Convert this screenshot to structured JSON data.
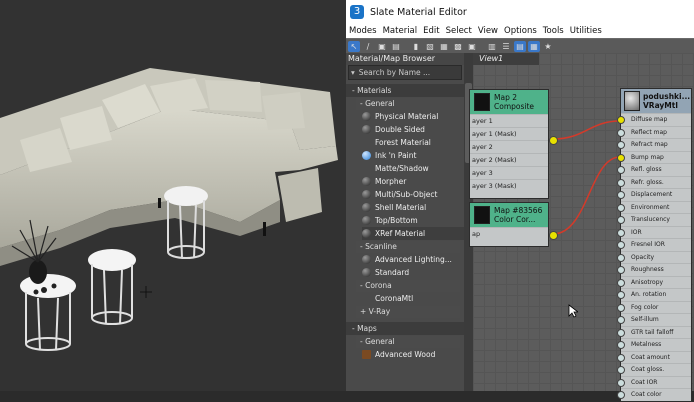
{
  "window": {
    "title": "Slate Material Editor",
    "icon_letter": "3"
  },
  "menu": [
    "Modes",
    "Material",
    "Edit",
    "Select",
    "View",
    "Options",
    "Tools",
    "Utilities"
  ],
  "browser": {
    "title": "Material/Map Browser",
    "search_placeholder": "Search by Name ...",
    "sections": {
      "materials": "- Materials",
      "general": "- General",
      "scanline": "- Scanline",
      "corona": "- Corona",
      "vray": "+ V-Ray",
      "maps": "- Maps",
      "maps_general": "- General"
    },
    "general_items": [
      "Physical Material",
      "Double Sided",
      "Forest Material",
      "Ink 'n Paint",
      "Matte/Shadow",
      "Morpher",
      "Multi/Sub-Object",
      "Shell Material",
      "Top/Bottom",
      "XRef Material"
    ],
    "scanline_items": [
      "Advanced Lighting...",
      "Standard"
    ],
    "corona_items": [
      "CoronaMtl"
    ],
    "maps_items": [
      "Advanced Wood"
    ]
  },
  "view": {
    "tab_label": "View1",
    "node_composite": {
      "title1": "Map 2",
      "title2": "Composite",
      "slots": [
        "ayer 1",
        "ayer 1 (Mask)",
        "ayer 2",
        "ayer 2 (Mask)",
        "ayer 3",
        "ayer 3 (Mask)"
      ]
    },
    "node_color": {
      "title1": "Map #83566",
      "title2": "Color Cor...",
      "slots": [
        "ap"
      ]
    },
    "node_vray": {
      "title1": "podushki...",
      "title2": "VRayMtl",
      "slots": [
        "Diffuse map",
        "Reflect map",
        "Refract map",
        "Bump map",
        "Refl. gloss",
        "Refr. gloss.",
        "Displacement",
        "Environment",
        "Translucency",
        "IOR",
        "Fresnel IOR",
        "Opacity",
        "Roughness",
        "Anisotropy",
        "An. rotation",
        "Fog color",
        "Self-illum",
        "GTR tail falloff",
        "Metalness",
        "Coat amount",
        "Coat gloss.",
        "Coat IOR",
        "Coat color"
      ]
    }
  },
  "colors": {
    "node_header_green": "#4fb28a",
    "wire_red": "#d43a2a",
    "connector_yellow": "#e8e100",
    "accent_blue": "#3a78c9"
  }
}
